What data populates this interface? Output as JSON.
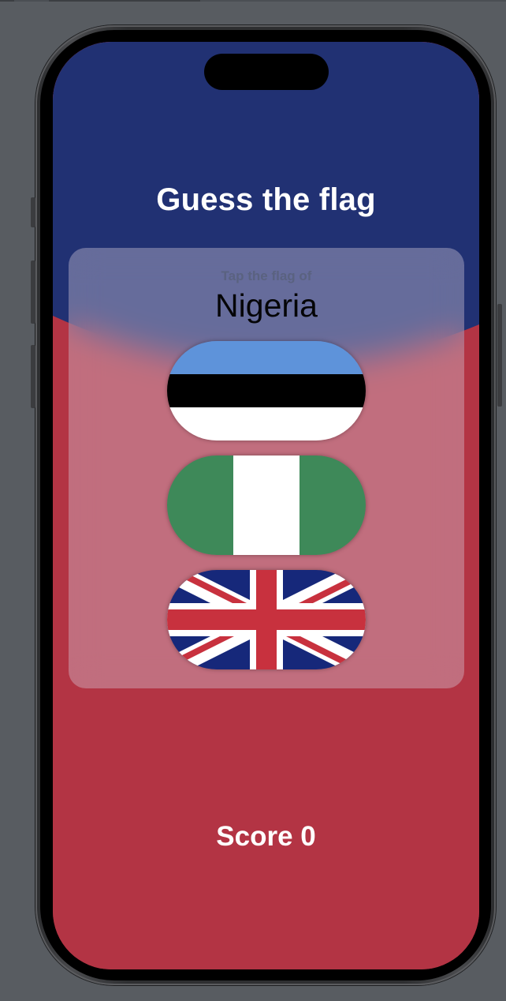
{
  "app": {
    "title": "Guess the flag",
    "prompt_label": "Tap the flag of",
    "target_country": "Nigeria",
    "score_text": "Score 0"
  },
  "flags": [
    {
      "country": "Estonia",
      "icon": "estonia-flag"
    },
    {
      "country": "Nigeria",
      "icon": "nigeria-flag"
    },
    {
      "country": "UK",
      "icon": "uk-flag"
    }
  ],
  "colors": {
    "background_top": "#213173",
    "background_bottom": "#b33444",
    "card_overlay": "rgba(215,205,220,0.38)",
    "title_text": "#ffffff",
    "subtitle_text": "#5a6280"
  }
}
